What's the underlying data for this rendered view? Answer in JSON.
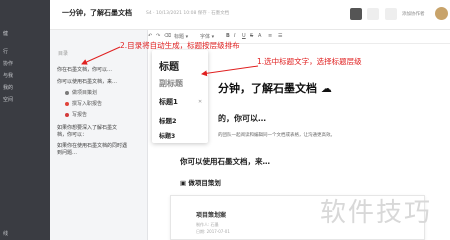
{
  "sidebar": {
    "items": [
      "健",
      "行",
      "协作",
      "与我",
      "我的",
      "空间",
      "线"
    ]
  },
  "outline": {
    "title": "目录",
    "items": [
      {
        "label": "你可以使用石墨文档，来…",
        "level": 1
      },
      {
        "label": "做项目策划",
        "level": 2,
        "icon_color": "#7a7a7a"
      },
      {
        "label": "撰写入职报告",
        "level": 2,
        "icon_color": "#e0433a"
      },
      {
        "label": "写报告",
        "level": 2,
        "icon_color": "#d33b3b"
      },
      {
        "label": "如果你想要深入了解石墨文",
        "level": 1
      },
      {
        "label": "如果你在使用石墨文档的同时遇",
        "level": 1
      }
    ],
    "first": "你在石墨文档，你可以…",
    "extra": [
      "档，你可以：",
      "到问题…"
    ]
  },
  "header": {
    "doc_title": "一分钟，了解石墨文档",
    "doc_meta": "S4 · 10/13/2021 10:08 保存 · 石墨文档",
    "collaborate": "添加协作者",
    "share": "分享"
  },
  "toolbar": {
    "style_select": "标题 ▾",
    "font_select": "字体 ▾",
    "buttons": [
      "↶",
      "↷",
      "⌫",
      "B",
      "I",
      "U",
      "S",
      "A",
      "≡",
      "☰"
    ]
  },
  "dropdown": {
    "items": [
      {
        "label": "标题",
        "style": "title"
      },
      {
        "label": "副标题",
        "style": "subtitle"
      },
      {
        "label": "标题1",
        "style": "h1",
        "check": "✕"
      },
      {
        "label": "标题2",
        "style": "h2"
      },
      {
        "label": "标题3",
        "style": "h3"
      }
    ]
  },
  "doc": {
    "h1": "分钟，了解石墨文档 ☁",
    "h2_a": "的，你可以…",
    "p": "的团队一起阅读和编辑同一个文档或表格，让沟通更高效。",
    "h2_b": "你可以使用石墨文档，来…",
    "h3": "▣ 做项目策划",
    "card_title": "项目策划案",
    "card_lines": [
      "制作人: 石墨",
      "日期: 2017-07-01"
    ]
  },
  "annotations": {
    "a1": "1.选中标题文字，选择标题层级",
    "a2": "2.目录将自动生成，标题按层级排布"
  },
  "watermark": "软件技巧",
  "colors": {
    "annotation": "#e02020",
    "sidebar": "#3a3c42",
    "brand": "#3a7ee0"
  }
}
